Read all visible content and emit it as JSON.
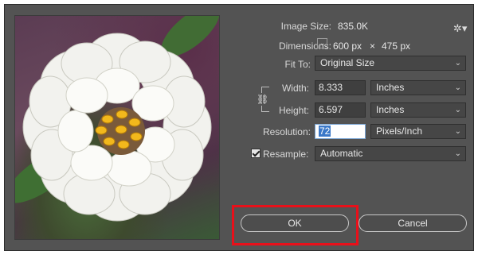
{
  "image_size": {
    "label": "Image Size:",
    "value": "835.0K"
  },
  "dimensions": {
    "label": "Dimensions:",
    "width": "600 px",
    "times": "×",
    "height": "475 px"
  },
  "fit_to": {
    "label": "Fit To:",
    "value": "Original Size"
  },
  "width": {
    "label": "Width:",
    "value": "8.333",
    "unit": "Inches"
  },
  "height": {
    "label": "Height:",
    "value": "6.597",
    "unit": "Inches"
  },
  "resolution": {
    "label": "Resolution:",
    "value": "72",
    "unit": "Pixels/Inch"
  },
  "resample": {
    "label": "Resample:",
    "value": "Automatic",
    "checked": true
  },
  "buttons": {
    "ok": "OK",
    "cancel": "Cancel"
  },
  "icons": {
    "gear": "gear-icon",
    "link": "link-icon",
    "chevron": "chevron-down-icon"
  },
  "colors": {
    "dialog_bg": "#535353",
    "highlight": "#e8101a",
    "field_active": "#3a78c8"
  }
}
